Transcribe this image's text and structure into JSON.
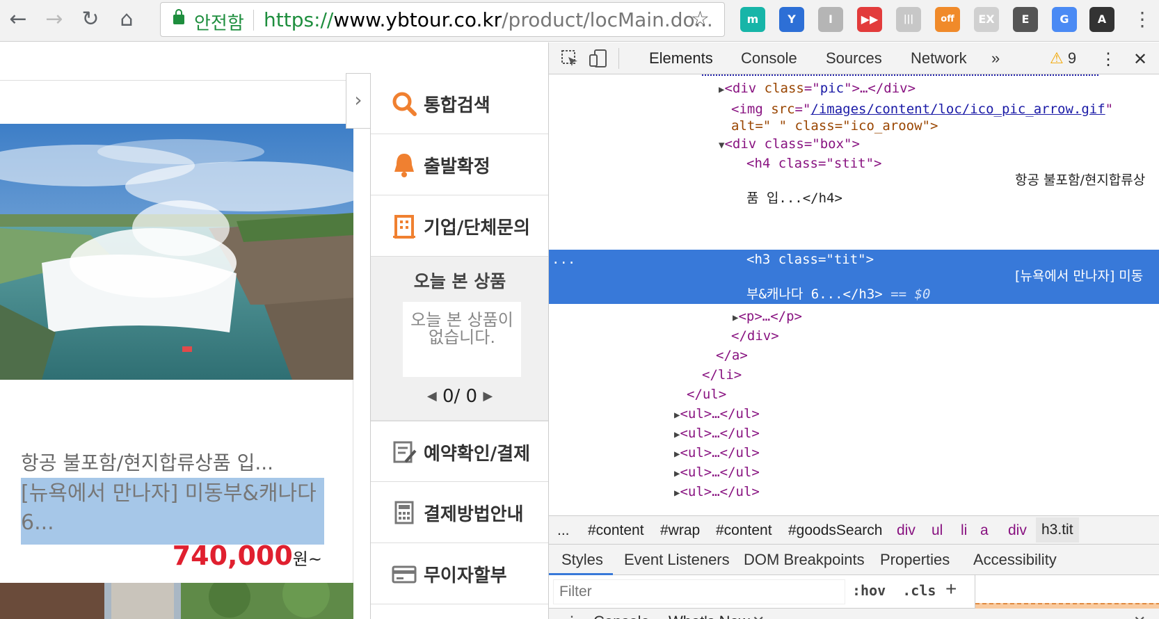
{
  "browser": {
    "secure_label": "안전함",
    "url_scheme": "https://",
    "url_host": "www.ybtour.co.kr",
    "url_path": "/product/locMain.do...",
    "extensions": [
      {
        "name": "m-extension-icon",
        "label": "m",
        "color": "#17b5a8"
      },
      {
        "name": "y-extension-icon",
        "label": "Y",
        "color": "#2d6fd6"
      },
      {
        "name": "gray-extension-icon",
        "label": "I",
        "color": "#b5b5b5"
      },
      {
        "name": "video-extension-icon",
        "label": "▶▶",
        "color": "#e23b3b"
      },
      {
        "name": "barcode-extension-icon",
        "label": "|||",
        "color": "#c7c7c7"
      },
      {
        "name": "off-extension-icon",
        "label": "off",
        "color": "#f08a2a"
      },
      {
        "name": "ex-extension-icon",
        "label": "EX",
        "color": "#d0d0d0"
      },
      {
        "name": "evernote-extension-icon",
        "label": "E",
        "color": "#555555"
      },
      {
        "name": "translate-extension-icon",
        "label": "G",
        "color": "#4a8af4"
      },
      {
        "name": "font-extension-icon",
        "label": "A",
        "color": "#333333"
      }
    ]
  },
  "product": {
    "subtitle": "항공 불포함/현지합류상품 입...",
    "title": "[뉴욕에서 만나자] 미동부&캐나다 6...",
    "price": "740,000",
    "price_unit": "원~"
  },
  "quick_menu": {
    "items": [
      {
        "label": "통합검색",
        "icon": "search-icon"
      },
      {
        "label": "출발확정",
        "icon": "bell-icon"
      },
      {
        "label": "기업/단체문의",
        "icon": "building-icon"
      },
      {
        "label": "예약확인/결제",
        "icon": "reservation-icon"
      },
      {
        "label": "결제방법안내",
        "icon": "calculator-icon"
      },
      {
        "label": "무이자할부",
        "icon": "card-icon"
      }
    ],
    "recent_title": "오늘 본 상품",
    "recent_empty": "오늘 본 상품이 없습니다.",
    "recent_page": "0/ 0"
  },
  "devtools": {
    "tabs": [
      "Elements",
      "Console",
      "Sources",
      "Network"
    ],
    "more_tabs": "»",
    "warning_count": "9",
    "tree": {
      "pic_div": [
        "<div ",
        "class",
        "=\"",
        "pic",
        "\">…</div>"
      ],
      "img_src_attr": "src",
      "img_src": "/images/content/loc/ico_pic_arrow.gif",
      "img_alt_line": "alt=\" \" class=\"ico_aroow\">",
      "box_div": "<div class=\"box\">",
      "h4_open": "<h4 class=\"stit\">",
      "h4_text_1": "항공 불포함/현지합류상",
      "h4_text_2": "품 입...</h4>",
      "h3_open": "<h3 class=\"tit\">",
      "h3_text_1": "[뉴욕에서 만나자] 미동",
      "h3_text_2": "부&캐나다 6...</h3>",
      "h3_marker": "== $0",
      "p_line": "<p>…</p>",
      "close_div": "</div>",
      "close_a": "</a>",
      "close_li": "</li>",
      "close_ul": "</ul>",
      "ul_collapsed": "<ul>…</ul>"
    },
    "breadcrumbs": [
      "...",
      "#content",
      "#wrap",
      "#content",
      "#goodsSearch",
      "div",
      "ul",
      "li",
      "a",
      "div",
      "h3.tit"
    ],
    "subtabs": [
      "Styles",
      "Event Listeners",
      "DOM Breakpoints",
      "Properties",
      "Accessibility"
    ],
    "filter_placeholder": "Filter",
    "hov_label": ":hov",
    "cls_label": ".cls",
    "drawer_tabs": [
      "Console",
      "What's New"
    ]
  }
}
